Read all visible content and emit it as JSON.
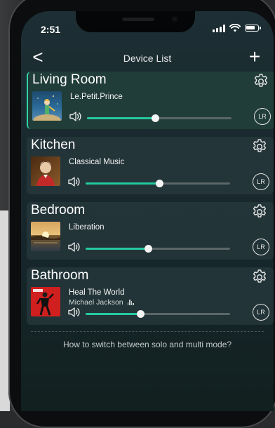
{
  "status": {
    "time": "2:51"
  },
  "nav": {
    "back_glyph": "<",
    "title": "Device List",
    "add_glyph": "+"
  },
  "devices": [
    {
      "room": "Living Room",
      "track": "Le.Petit.Prince",
      "artist": "",
      "volume": 0.47,
      "channel": "LR",
      "active": true,
      "icon": "speaker-icon"
    },
    {
      "room": "Kitchen",
      "track": "Classical Music",
      "artist": "",
      "volume": 0.51,
      "channel": "LR",
      "active": false,
      "icon": "speaker-icon"
    },
    {
      "room": "Bedroom",
      "track": "Liberation",
      "artist": "",
      "volume": 0.43,
      "channel": "LR",
      "active": false,
      "icon": "speaker-icon"
    },
    {
      "room": "Bathroom",
      "track": "Heal The World",
      "artist": "Michael Jackson",
      "volume": 0.38,
      "channel": "LR",
      "active": false,
      "icon": "speaker-icon"
    }
  ],
  "help_text": "How to switch between solo and multi mode?",
  "colors": {
    "accent": "#25c9a0",
    "background": "#16262b",
    "card": "#283a3e"
  }
}
